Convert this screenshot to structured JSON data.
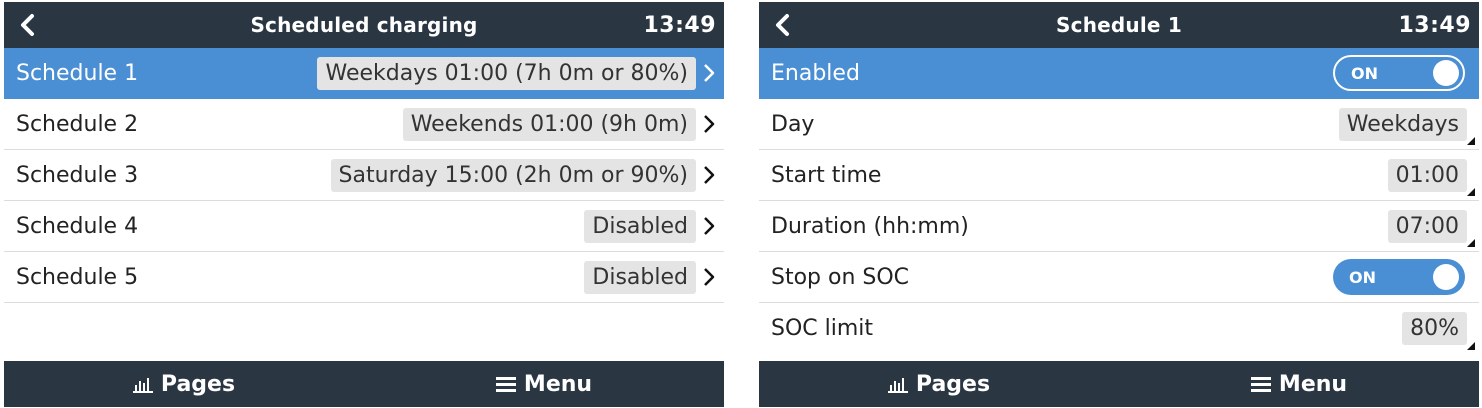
{
  "left": {
    "title": "Scheduled charging",
    "time": "13:49",
    "rows": [
      {
        "label": "Schedule 1",
        "value": "Weekdays 01:00 (7h 0m or 80%)",
        "selected": true
      },
      {
        "label": "Schedule 2",
        "value": "Weekends 01:00 (9h 0m)",
        "selected": false
      },
      {
        "label": "Schedule 3",
        "value": "Saturday 15:00 (2h 0m or 90%)",
        "selected": false
      },
      {
        "label": "Schedule 4",
        "value": "Disabled",
        "selected": false
      },
      {
        "label": "Schedule 5",
        "value": "Disabled",
        "selected": false
      }
    ],
    "bottom": {
      "pages": "Pages",
      "menu": "Menu"
    }
  },
  "right": {
    "title": "Schedule 1",
    "time": "13:49",
    "rows": {
      "enabled": {
        "label": "Enabled",
        "toggle": "ON"
      },
      "day": {
        "label": "Day",
        "value": "Weekdays"
      },
      "start": {
        "label": "Start time",
        "value": "01:00"
      },
      "duration": {
        "label": "Duration (hh:mm)",
        "value": "07:00"
      },
      "stop_soc": {
        "label": "Stop on SOC",
        "toggle": "ON"
      },
      "soc_limit": {
        "label": "SOC limit",
        "value": "80%"
      }
    },
    "bottom": {
      "pages": "Pages",
      "menu": "Menu"
    }
  },
  "icons": {
    "back": "chevron-left-icon",
    "row_arrow": "chevron-right-icon",
    "pages": "bar-chart-icon",
    "menu": "hamburger-menu-icon"
  },
  "colors": {
    "header_bg": "#2b3643",
    "selected_bg": "#4a8fd4",
    "value_bg": "#e4e4e4",
    "toggle_on": "#4a8fd4"
  }
}
